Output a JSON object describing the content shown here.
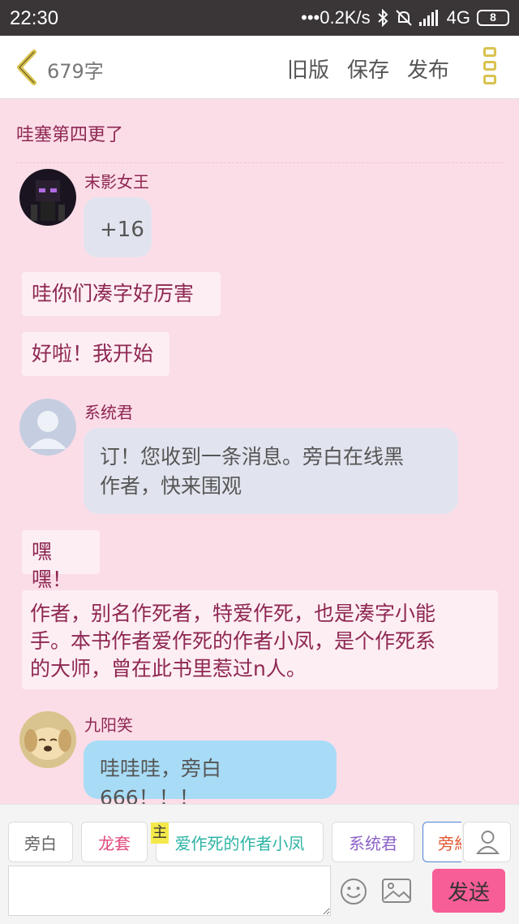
{
  "status_bar": {
    "time": "22:30",
    "network": "•••0.2K/s",
    "signal": "4G",
    "battery": "8"
  },
  "title_bar": {
    "word_count": "679字",
    "old_version": "旧版",
    "save": "保存",
    "publish": "发布"
  },
  "chapter_title": "哇塞第四更了",
  "messages": [
    {
      "type": "character",
      "name": "末影女王",
      "text": "+16",
      "bubble_color": "#e1e4ee"
    },
    {
      "type": "narration",
      "text": "哇你们凑字好厉害"
    },
    {
      "type": "narration",
      "text": "好啦！我开始"
    },
    {
      "type": "character",
      "name": "系统君",
      "text_line1": "订！您收到一条消息。旁白在线黑",
      "text_line2": "作者，快来围观",
      "bubble_color": "#e1e4ee"
    },
    {
      "type": "narration",
      "text": "嘿嘿！"
    },
    {
      "type": "narration",
      "text_line1": "作者，别名作死者，特爱作死，也是凑字小能",
      "text_line2": "手。本书作者爱作死的作者小凤，是个作死系",
      "text_line3": "的大师，曾在此书里惹过n人。"
    },
    {
      "type": "character",
      "name": "九阳笑",
      "text": "哇哇哇，旁白666！！！",
      "bubble_color": "#a8dcf6"
    }
  ],
  "roles": [
    {
      "label": "旁白",
      "color": "#666666"
    },
    {
      "label": "龙套",
      "color": "#e24a7c"
    },
    {
      "label": "爱作死的作者小凤",
      "badge": "主",
      "color": "#2fb4a5"
    },
    {
      "label": "系统君",
      "color": "#8d63c8"
    },
    {
      "label": "旁糾",
      "color": "#e05a33"
    }
  ],
  "input": {
    "placeholder": ""
  },
  "send_label": "发送",
  "colors": {
    "accent_pink": "#f75d97",
    "name_color": "#8e2752",
    "background": "#fbdde8"
  }
}
